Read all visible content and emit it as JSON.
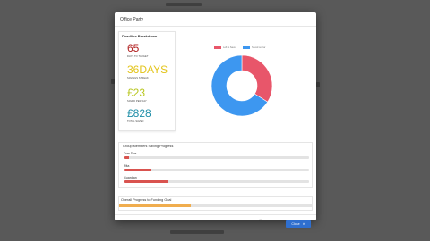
{
  "modal": {
    "title": "Office Party"
  },
  "stats": {
    "heading": "Deadline Breakdown",
    "items": [
      {
        "value": "65",
        "caption": "DAYS TO TARGET",
        "color": "#b22222"
      },
      {
        "value": "36DAYS",
        "caption": "SAVINGS STREAK",
        "color": "#e3c41a"
      },
      {
        "value": "£23",
        "caption": "SAVED PER DAY",
        "color": "#b8c61f"
      },
      {
        "value": "£828",
        "caption": "TOTAL SAVED",
        "color": "#1f8ea8"
      }
    ]
  },
  "chart_data": {
    "type": "pie",
    "categories": [
      "Left to Save",
      "Saved so Far"
    ],
    "values": [
      0.34,
      0.66
    ],
    "colors": [
      "#e8566a",
      "#3d97f0"
    ],
    "legend_position": "top",
    "donut": true
  },
  "group_progress": {
    "heading": "Group Members Saving Progress",
    "members": [
      {
        "name": "Tom Doe",
        "progress": 0.03
      },
      {
        "name": "Rita",
        "progress": 0.15
      },
      {
        "name": "Guardian",
        "progress": 0.24
      }
    ],
    "fill_color": "#d9534f"
  },
  "overall": {
    "heading": "Overall Progress to Funding Goal",
    "progress": 0.37,
    "fill_color": "#f0ad4e"
  },
  "footer": {
    "close_label": "Close"
  }
}
